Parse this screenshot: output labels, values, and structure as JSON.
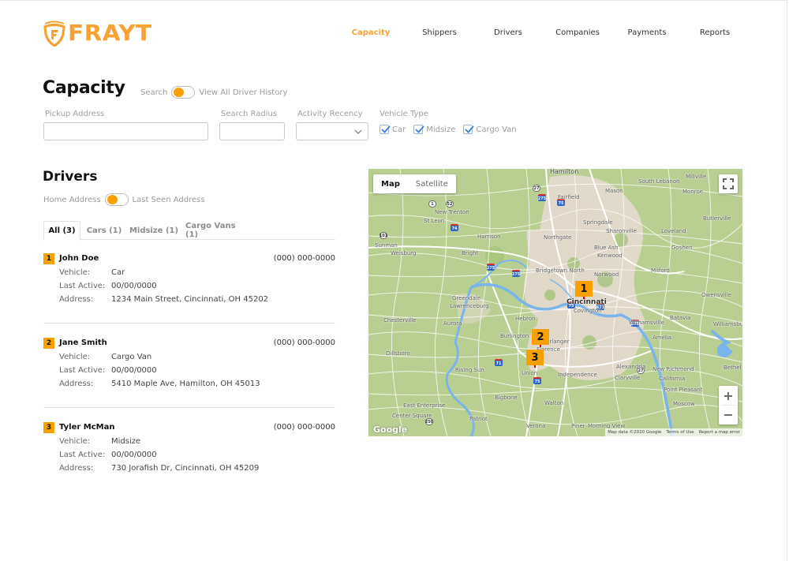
{
  "brand": {
    "name": "FRAYT",
    "color": "#f7a233"
  },
  "nav": {
    "items": [
      {
        "label": "Capacity",
        "active": true
      },
      {
        "label": "Shippers",
        "active": false
      },
      {
        "label": "Drivers",
        "active": false
      },
      {
        "label": "Companies",
        "active": false
      },
      {
        "label": "Payments",
        "active": false
      },
      {
        "label": "Reports",
        "active": false
      }
    ]
  },
  "page": {
    "title": "Capacity",
    "mode_toggle": {
      "left_label": "Search",
      "right_label": "View All Driver History",
      "state": "left"
    }
  },
  "filters": {
    "pickup_address": {
      "label": "Pickup Address",
      "value": "",
      "placeholder": ""
    },
    "search_radius": {
      "label": "Search Radius",
      "value": "",
      "placeholder": ""
    },
    "activity_recency": {
      "label": "Activity Recency",
      "value": ""
    },
    "vehicle_type": {
      "label": "Vehicle Type",
      "options": [
        {
          "label": "Car",
          "checked": true
        },
        {
          "label": "Midsize",
          "checked": true
        },
        {
          "label": "Cargo Van",
          "checked": true
        }
      ]
    }
  },
  "drivers": {
    "title": "Drivers",
    "address_toggle": {
      "left_label": "Home Address",
      "right_label": "Last Seen Address",
      "state": "left"
    },
    "tabs": [
      {
        "label": "All (3)",
        "active": true
      },
      {
        "label": "Cars (1)",
        "active": false
      },
      {
        "label": "Midsize (1)",
        "active": false
      },
      {
        "label": "Cargo Vans (1)",
        "active": false
      }
    ],
    "field_labels": {
      "vehicle": "Vehicle:",
      "last_active": "Last Active:",
      "address": "Address:"
    },
    "list": [
      {
        "index": "1",
        "name": "John Doe",
        "phone": "(000) 000-0000",
        "vehicle": "Car",
        "last_active": "00/00/0000",
        "address": "1234 Main Street, Cincinnati, OH 45202"
      },
      {
        "index": "2",
        "name": "Jane Smith",
        "phone": "(000) 000-0000",
        "vehicle": "Cargo Van",
        "last_active": "00/00/0000",
        "address": "5410 Maple Ave, Hamilton, OH 45013"
      },
      {
        "index": "3",
        "name": "Tyler McMan",
        "phone": "(000) 000-0000",
        "vehicle": "Midsize",
        "last_active": "00/00/0000",
        "address": "730 Jorafish Dr, Cincinnati, OH 45209"
      }
    ]
  },
  "map": {
    "type_controls": [
      {
        "label": "Map",
        "active": true
      },
      {
        "label": "Satellite",
        "active": false
      }
    ],
    "fullscreen_icon": "fullscreen-icon",
    "zoom_in": "+",
    "zoom_out": "−",
    "google_logo": "Google",
    "attribution": [
      "Map data ©2020 Google",
      "Terms of Use",
      "Report a map error"
    ],
    "markers": [
      "1",
      "2",
      "3"
    ],
    "places": {
      "cincinnati": "Cincinnati",
      "covington": "Covington",
      "hamilton": "Hamilton",
      "fairfield": "Fairfield",
      "mason": "Mason",
      "south_lebanon": "South Lebanon",
      "monroe": "Monroe",
      "millville": "Millville",
      "new_trenton": "New Trenton",
      "st_leon": "St Leon",
      "harrison": "Harrison",
      "northgate": "Northgate",
      "springdale": "Springdale",
      "sharonville": "Sharonville",
      "loveland": "Loveland",
      "butlerville": "Butlerville",
      "sunman": "Sunman",
      "weisburg": "Weisburg",
      "bright": "Bright",
      "bridgetown_north": "Bridgetown North",
      "blue_ash": "Blue Ash",
      "kenwood": "Kenwood",
      "goshen": "Goshen",
      "norwood": "Norwood",
      "milford": "Milford",
      "owensville": "Owensville",
      "greendale": "Greendale",
      "lawrenceburg": "Lawrenceburg",
      "chesterville": "Chesterville",
      "aurora": "Aurora",
      "dillsboro": "Dillsboro",
      "hebron": "Hebron",
      "burlington": "Burlington",
      "erlanger": "Erlanger",
      "florence": "Florence",
      "batavia": "Batavia",
      "withamsville": "Withamsville",
      "williamsburg": "Williamsburg",
      "amelia": "Amelia",
      "rising_sun": "Rising Sun",
      "union": "Union",
      "independence": "Independence",
      "alexandria": "Alexandria",
      "new_richmond": "New Richmond",
      "bethel": "Bethel",
      "claryville": "Claryville",
      "california": "California",
      "point_pleasant": "Point Pleasant",
      "bigbone": "Bigbone",
      "walton": "Walton",
      "east_enterprise": "East Enterprise",
      "center_square": "Center Square",
      "patriot": "Patriot",
      "verona": "Verona",
      "moscow": "Moscow",
      "piner": "Piner",
      "morning_view": "Morning View"
    }
  }
}
